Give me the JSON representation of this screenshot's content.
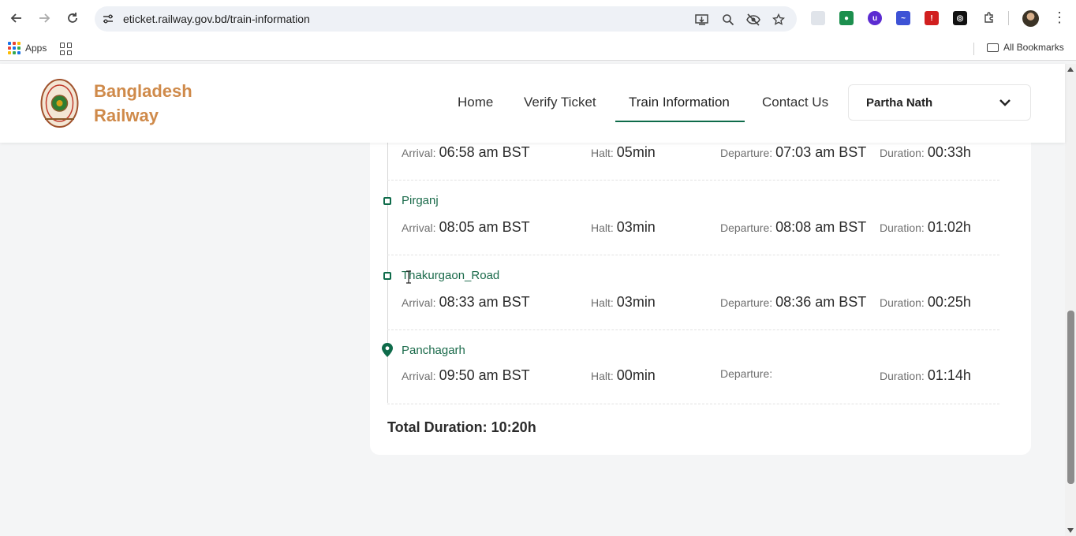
{
  "browser": {
    "url": "eticket.railway.gov.bd/train-information",
    "bookmarks": {
      "apps_label": "Apps",
      "all_bookmarks_label": "All Bookmarks"
    }
  },
  "header": {
    "brand_line1": "Bangladesh",
    "brand_line2": "Railway",
    "nav": [
      {
        "label": "Home"
      },
      {
        "label": "Verify Ticket"
      },
      {
        "label": "Train Information",
        "active": true
      },
      {
        "label": "Contact Us"
      }
    ],
    "user_name": "Partha Nath"
  },
  "labels": {
    "arrival": "Arrival:",
    "halt": "Halt:",
    "departure": "Departure:",
    "duration": "Duration:"
  },
  "stops": [
    {
      "station": "",
      "arrival": "06:58 am BST",
      "halt": "05min",
      "departure": "07:03 am BST",
      "duration": "00:33h"
    },
    {
      "station": "Pirganj",
      "arrival": "08:05 am BST",
      "halt": "03min",
      "departure": "08:08 am BST",
      "duration": "01:02h"
    },
    {
      "station": "Thakurgaon_Road",
      "arrival": "08:33 am BST",
      "halt": "03min",
      "departure": "08:36 am BST",
      "duration": "00:25h"
    },
    {
      "station": "Panchagarh",
      "arrival": "09:50 am BST",
      "halt": "00min",
      "departure": "",
      "duration": "01:14h"
    }
  ],
  "total_duration": "Total Duration: 10:20h",
  "colors": {
    "brand": "#cf8a4a",
    "accent": "#0e6b4a"
  }
}
